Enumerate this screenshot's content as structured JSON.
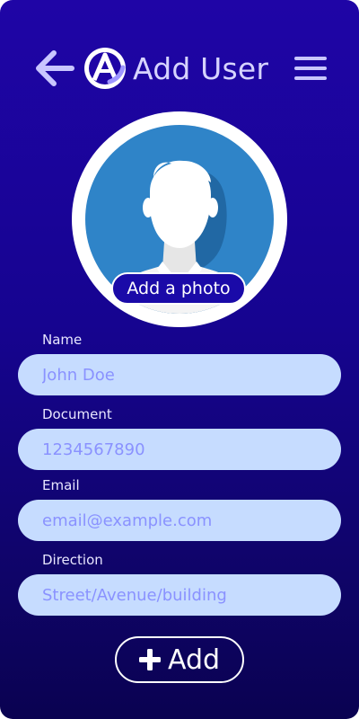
{
  "header": {
    "title": "Add User"
  },
  "avatar": {
    "add_photo_label": "Add a photo"
  },
  "form": {
    "name": {
      "label": "Name",
      "placeholder": "John Doe"
    },
    "document": {
      "label": "Document",
      "placeholder": "1234567890"
    },
    "email": {
      "label": "Email",
      "placeholder": "email@example.com"
    },
    "direction": {
      "label": "Direction",
      "placeholder": "Street/Avenue/building"
    }
  },
  "actions": {
    "add_label": "Add"
  },
  "icons": {
    "back": "arrow-left-icon",
    "logo": "app-logo-icon",
    "menu": "hamburger-menu-icon",
    "plus": "plus-icon"
  },
  "colors": {
    "background_top": "#1f05a6",
    "background_bottom": "#0a0251",
    "input_bg": "#c6dcff",
    "placeholder": "#8a92ff",
    "avatar_bg": "#2f84c8",
    "title": "#d6d3ff"
  }
}
